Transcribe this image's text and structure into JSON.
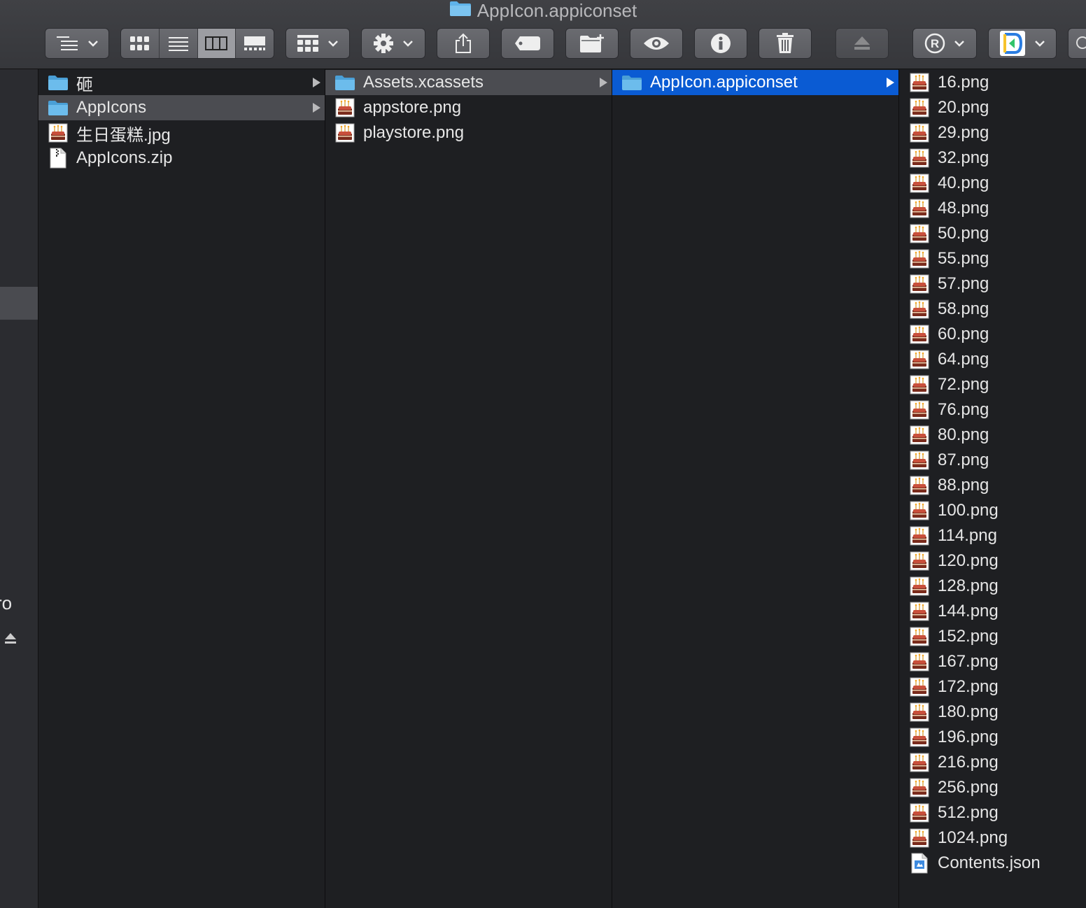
{
  "window": {
    "title": "AppIcon.appiconset"
  },
  "toolbar": {
    "icons": [
      "list-outline-icon",
      "chevron-down-icon",
      "icon-view-icon",
      "list-view-icon",
      "column-view-icon",
      "gallery-view-icon",
      "group-icon",
      "gear-icon",
      "share-icon",
      "tag-icon",
      "new-folder-icon",
      "eye-icon",
      "info-icon",
      "trash-icon",
      "eject-icon",
      "registered-icon",
      "app-icon",
      "search-icon"
    ]
  },
  "sidebar": {
    "partial_label": "ro"
  },
  "columns": {
    "col1": [
      {
        "name": "砸",
        "kind": "folder",
        "has_arrow": true,
        "selected": false
      },
      {
        "name": "AppIcons",
        "kind": "folder",
        "has_arrow": true,
        "selected": "gray"
      },
      {
        "name": "生日蛋糕.jpg",
        "kind": "image",
        "has_arrow": false,
        "selected": false
      },
      {
        "name": "AppIcons.zip",
        "kind": "zip",
        "has_arrow": false,
        "selected": false
      }
    ],
    "col2": [
      {
        "name": "Assets.xcassets",
        "kind": "folder",
        "has_arrow": true,
        "selected": "gray"
      },
      {
        "name": "appstore.png",
        "kind": "image",
        "has_arrow": false,
        "selected": false
      },
      {
        "name": "playstore.png",
        "kind": "image",
        "has_arrow": false,
        "selected": false
      }
    ],
    "col3": [
      {
        "name": "AppIcon.appiconset",
        "kind": "folder",
        "has_arrow": true,
        "selected": "blue"
      }
    ],
    "col4": [
      {
        "name": "16.png",
        "kind": "image"
      },
      {
        "name": "20.png",
        "kind": "image"
      },
      {
        "name": "29.png",
        "kind": "image"
      },
      {
        "name": "32.png",
        "kind": "image"
      },
      {
        "name": "40.png",
        "kind": "image"
      },
      {
        "name": "48.png",
        "kind": "image"
      },
      {
        "name": "50.png",
        "kind": "image"
      },
      {
        "name": "55.png",
        "kind": "image"
      },
      {
        "name": "57.png",
        "kind": "image"
      },
      {
        "name": "58.png",
        "kind": "image"
      },
      {
        "name": "60.png",
        "kind": "image"
      },
      {
        "name": "64.png",
        "kind": "image"
      },
      {
        "name": "72.png",
        "kind": "image"
      },
      {
        "name": "76.png",
        "kind": "image"
      },
      {
        "name": "80.png",
        "kind": "image"
      },
      {
        "name": "87.png",
        "kind": "image"
      },
      {
        "name": "88.png",
        "kind": "image"
      },
      {
        "name": "100.png",
        "kind": "image"
      },
      {
        "name": "114.png",
        "kind": "image"
      },
      {
        "name": "120.png",
        "kind": "image"
      },
      {
        "name": "128.png",
        "kind": "image"
      },
      {
        "name": "144.png",
        "kind": "image"
      },
      {
        "name": "152.png",
        "kind": "image"
      },
      {
        "name": "167.png",
        "kind": "image"
      },
      {
        "name": "172.png",
        "kind": "image"
      },
      {
        "name": "180.png",
        "kind": "image"
      },
      {
        "name": "196.png",
        "kind": "image"
      },
      {
        "name": "216.png",
        "kind": "image"
      },
      {
        "name": "256.png",
        "kind": "image"
      },
      {
        "name": "512.png",
        "kind": "image"
      },
      {
        "name": "1024.png",
        "kind": "image"
      },
      {
        "name": "Contents.json",
        "kind": "json"
      }
    ]
  },
  "colors": {
    "selection_blue": "#0a5bd3",
    "selection_gray": "#4b4c51",
    "folder_blue": "#5fb3ea",
    "background": "#1e1f22"
  }
}
